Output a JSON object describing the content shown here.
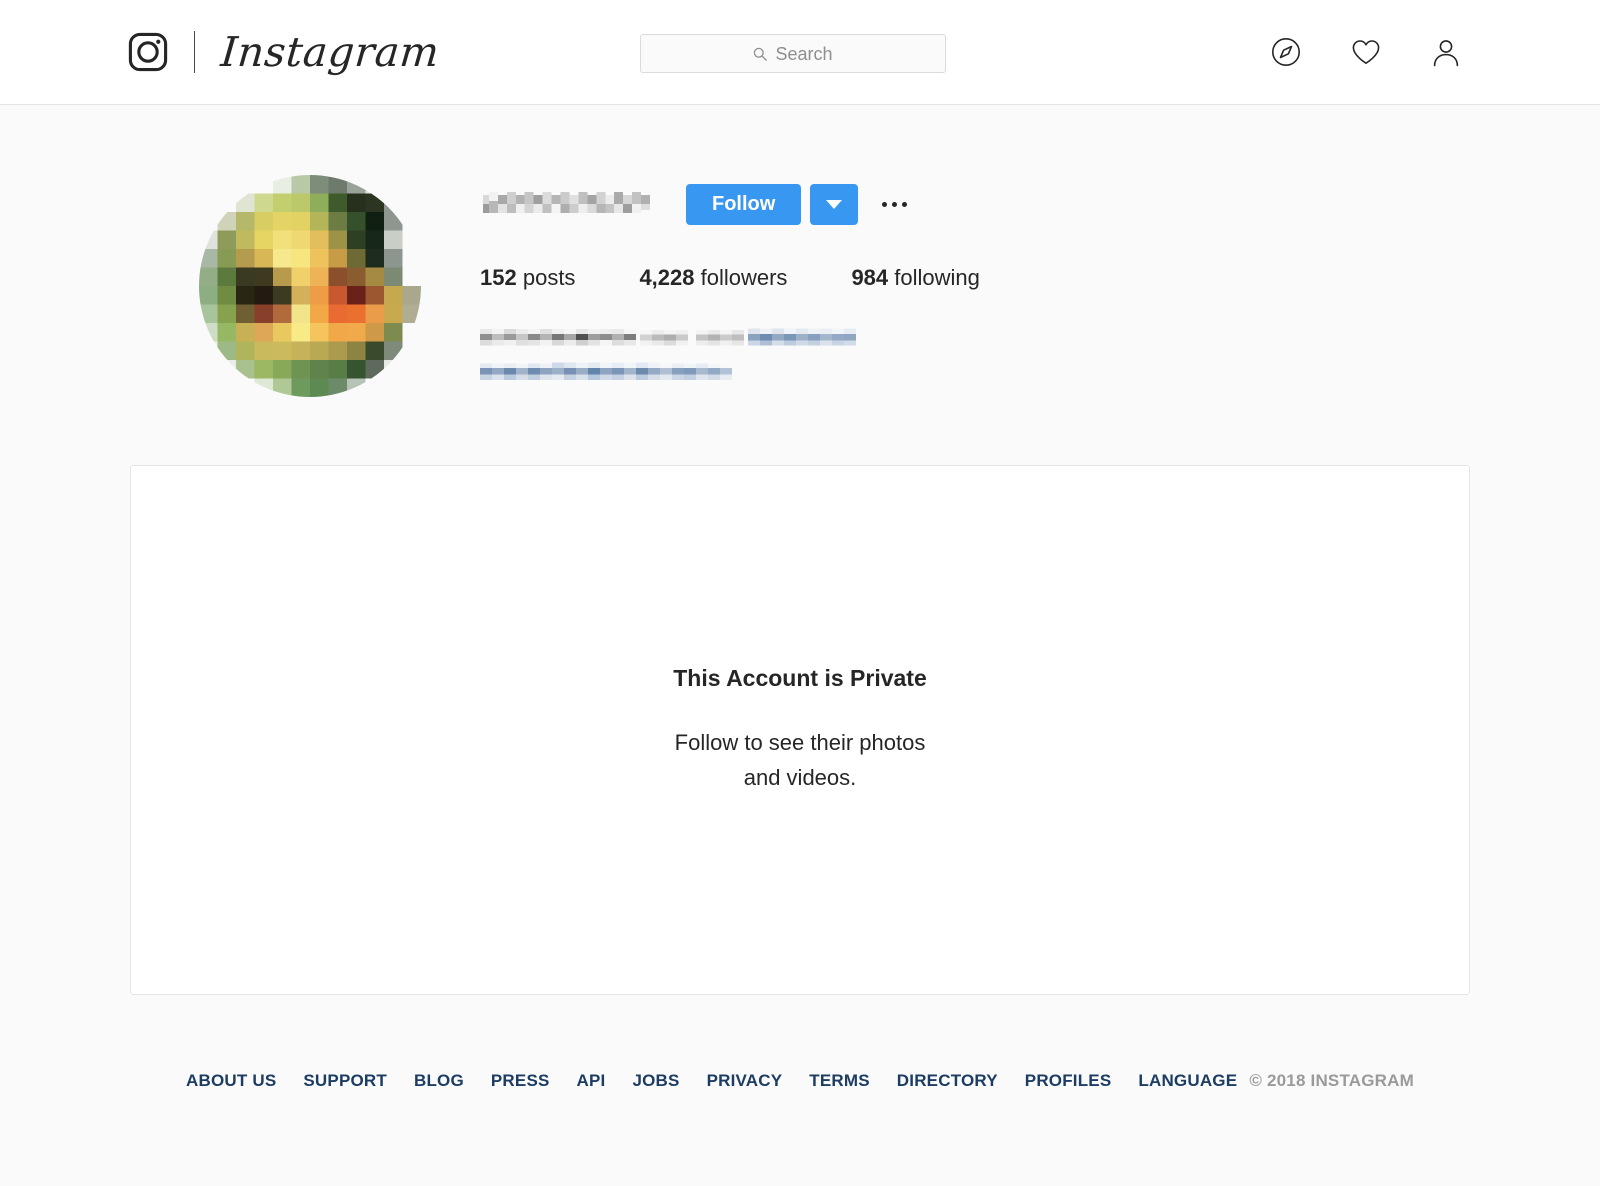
{
  "header": {
    "brand_name": "Instagram",
    "icons": {
      "camera": "instagram-camera-icon",
      "search": "search-icon",
      "explore": "compass-icon",
      "activity": "heart-icon",
      "profile": "person-icon"
    },
    "search": {
      "placeholder": "Search",
      "value": ""
    }
  },
  "profile": {
    "avatar_alt": "profile-photo-pixelated",
    "username": "",
    "username_redacted": true,
    "follow_label": "Follow",
    "dropdown_label": "",
    "options_label": "",
    "stats": [
      {
        "value": "152",
        "label": "posts"
      },
      {
        "value": "4,228",
        "label": "followers"
      },
      {
        "value": "984",
        "label": "following"
      }
    ],
    "bio": {
      "redacted": true,
      "lines": [
        "",
        ""
      ]
    }
  },
  "content": {
    "private_title": "This Account is Private",
    "private_subtitle": "Follow to see their photos and videos."
  },
  "footer": {
    "links": [
      "ABOUT US",
      "SUPPORT",
      "BLOG",
      "PRESS",
      "API",
      "JOBS",
      "PRIVACY",
      "TERMS",
      "DIRECTORY",
      "PROFILES",
      "LANGUAGE"
    ],
    "copyright": "© 2018 INSTAGRAM"
  },
  "colors": {
    "accent_blue": "#3897f0",
    "page_bg": "#fafafa",
    "text": "#262626",
    "footer_link": "#1c3c63",
    "muted": "#9a9a9a"
  }
}
